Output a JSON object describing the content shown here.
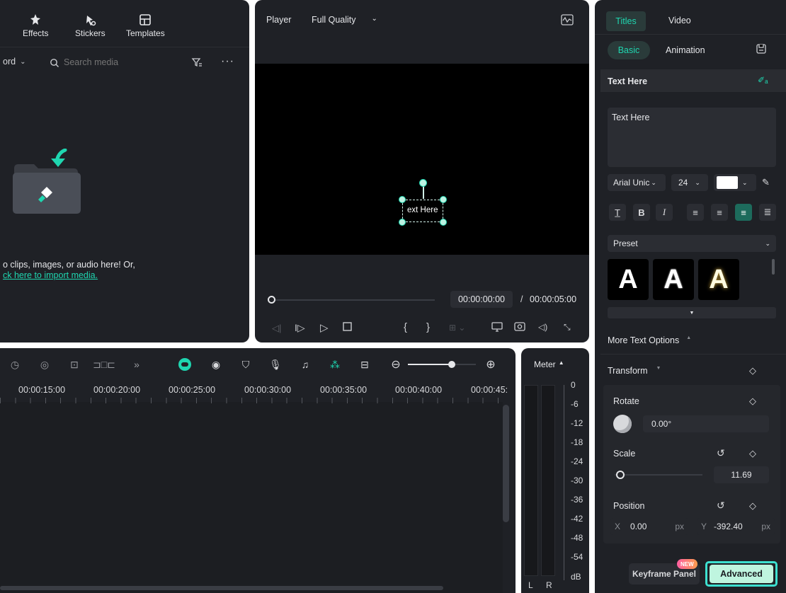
{
  "top_menu": {
    "effects": "Effects",
    "stickers": "Stickers",
    "templates": "Templates"
  },
  "media": {
    "sort_value": "ord",
    "search_placeholder": "Search media",
    "drop_text": "o clips, images, or audio here! Or,",
    "import_link": "ck here to import media."
  },
  "player": {
    "label": "Player",
    "quality": "Full Quality",
    "overlay_text": "ext Here",
    "current_time": "00:00:00:00",
    "separator": "/",
    "total_time": "00:00:05:00"
  },
  "timeline": {
    "ruler": [
      "00:00:15:00",
      "00:00:20:00",
      "00:00:25:00",
      "00:00:30:00",
      "00:00:35:00",
      "00:00:40:00",
      "00:00:45:"
    ],
    "zoom_level": 0.65
  },
  "meter": {
    "title": "Meter",
    "scale": [
      "0",
      "-6",
      "-12",
      "-18",
      "-24",
      "-30",
      "-36",
      "-42",
      "-48",
      "-54",
      "dB"
    ],
    "left": "L",
    "right": "R"
  },
  "inspector": {
    "tabs": [
      "Titles",
      "Video"
    ],
    "subtabs": [
      "Basic",
      "Animation"
    ],
    "section_title": "Text Here",
    "text_value": "Text Here",
    "font": "Arial Unic",
    "size": "24",
    "color": "#ffffff",
    "preset_label": "Preset",
    "preset_letter": "A",
    "more_options": "More Text Options",
    "transform": "Transform",
    "rotate_label": "Rotate",
    "rotate_value": "0.00°",
    "scale_label": "Scale",
    "scale_value": "11.69",
    "position_label": "Position",
    "x_label": "X",
    "x_value": "0.00",
    "y_label": "Y",
    "y_value": "-392.40",
    "unit": "px",
    "new_badge": "NEW",
    "keyframe_button": "Keyframe Panel",
    "advanced_button": "Advanced"
  },
  "colors": {
    "accent": "#1fd6b0",
    "panel": "#1f2126",
    "highlight_border": "#3de0d0"
  }
}
